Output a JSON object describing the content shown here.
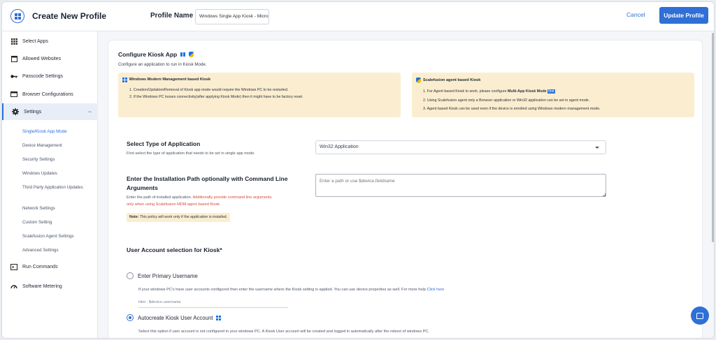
{
  "header": {
    "title": "Create New Profile",
    "profile_name_label": "Profile Name",
    "profile_name_value": "Windows Single App Kiosk - Micro",
    "cancel_label": "Cancel",
    "update_label": "Update Profile"
  },
  "sidebar": {
    "items": [
      {
        "label": "Select Apps",
        "icon": "grid-icon"
      },
      {
        "label": "Allowed Websites",
        "icon": "browser-window-icon"
      },
      {
        "label": "Passcode Settings",
        "icon": "key-icon"
      },
      {
        "label": "Browser Configurations",
        "icon": "browser-icon"
      },
      {
        "label": "Settings",
        "icon": "gear-icon"
      },
      {
        "label": "Run Commands",
        "icon": "terminal-icon"
      },
      {
        "label": "Software Metering",
        "icon": "gauge-icon"
      }
    ],
    "settings_sub": [
      "Single/Kiosk App Mode",
      "Device Management",
      "Security Settings",
      "Windows Updates",
      "Third Party Application Updates",
      "Network Settings",
      "Custom Setting",
      "Scalefusion Agent Settings",
      "Advanced Settings"
    ],
    "collapse_symbol": "−"
  },
  "main": {
    "title": "Configure Kiosk App",
    "subtitle": "Configure an application to run in Kiosk Mode.",
    "notes": {
      "left": {
        "title": "Windows Modern Management based Kiosk",
        "lines": [
          "1. Creation/Updation/Removal of Kiosk app mode would require the Windows PC to be restarted.",
          "2. If the Windows PC looses connectivity(after applying Kiosk Mode) then it might have to be factory reset."
        ]
      },
      "right": {
        "title": "Scalefusion agent based Kiosk",
        "line1_pre": "1. For Agent based Kiosk to work, please configure ",
        "line1_bold": "Multi-App Kiosk Mode",
        "line1_link": "first",
        "lines": [
          "2. Using Scalefusion agent only a Browser application or Win32 application can be set in agent mode.",
          "3. Agent based Kiosk can be used even if the device is enrolled using Windows modern management mode."
        ]
      }
    },
    "app_type": {
      "title": "Select Type of Application",
      "subtitle": "First select the type of application that needs to be set in single app mode.",
      "selected": "Win32 Application"
    },
    "install_path": {
      "title_line1": "Enter the Installation Path optionally with Command Line",
      "title_line2": "Arguments",
      "sub_black": "Enter the path of installed application.",
      "sub_red_1": "Additionally provide command line arguments",
      "sub_red_2": "only when using Scalefusion MDM agent based Kiosk",
      "placeholder": "Enter a path or use $device.fieldname",
      "note_bold": "Note:",
      "note_text": "This policy will work only if the application is installed."
    },
    "user_account": {
      "title": "User Account selection for Kiosk*",
      "option1_label": "Enter Primary Username",
      "option1_desc": "If your windows PC's have user accounts configured then enter the username where the Kiosk setting is applied. You can use device properties as well. For more help",
      "option1_link": "Click here",
      "hint": "Hint - $device.username",
      "option2_label": "Autocreate Kiosk User Account",
      "option2_desc": "Select this option if user account is not configured in your windows PC. A Kiosk User account will be created and logged in automatically after the reboot of windows PC.",
      "selected": "autocreate"
    }
  },
  "colors": {
    "accent": "#2f6fd6",
    "note_bg": "#fbeed0",
    "warning_red": "#d84a3b"
  }
}
